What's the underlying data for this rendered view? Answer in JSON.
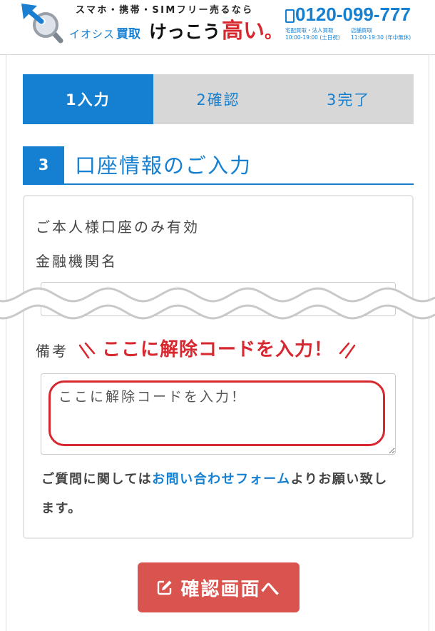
{
  "header": {
    "logo_icon": "magnifier-arrow-icon",
    "tagline": "スマホ・携帯・SIMフリー売るなら",
    "brand_name": "イオシス",
    "brand_service": "買取",
    "slogan_main": "けっこう",
    "slogan_accent": "高い",
    "slogan_period": "。",
    "phone_icon": "phone-icon",
    "phone_number": "0120-099-777",
    "hours": [
      {
        "label": "宅配買取・法人買取",
        "time": "10:00-19:00 (土日祝)"
      },
      {
        "label": "店舗買取",
        "time": "11:00-19:30 (年中無休)"
      }
    ]
  },
  "steps": [
    {
      "label": "1入力",
      "active": true
    },
    {
      "label": "2確認",
      "active": false
    },
    {
      "label": "3完了",
      "active": false
    }
  ],
  "section": {
    "number": "3",
    "title": "口座情報のご入力"
  },
  "form": {
    "note": "ご本人様口座のみ有効",
    "bank_label": "金融機関名",
    "remarks_label": "備考",
    "remarks_value": "ここに解除コードを入力！",
    "help": {
      "prefix": "ご質問に関しては",
      "link": "お問い合わせフォーム",
      "suffix": "よりお願い致します。"
    }
  },
  "callout": {
    "text": "ここに解除コードを入力！"
  },
  "submit": {
    "icon": "edit-icon",
    "label": "確認画面へ"
  },
  "colors": {
    "primary_blue": "#1580d1",
    "tab_inactive_bg": "#d7d7d7",
    "accent_red": "#d7282f",
    "button_red": "#d9534f"
  }
}
